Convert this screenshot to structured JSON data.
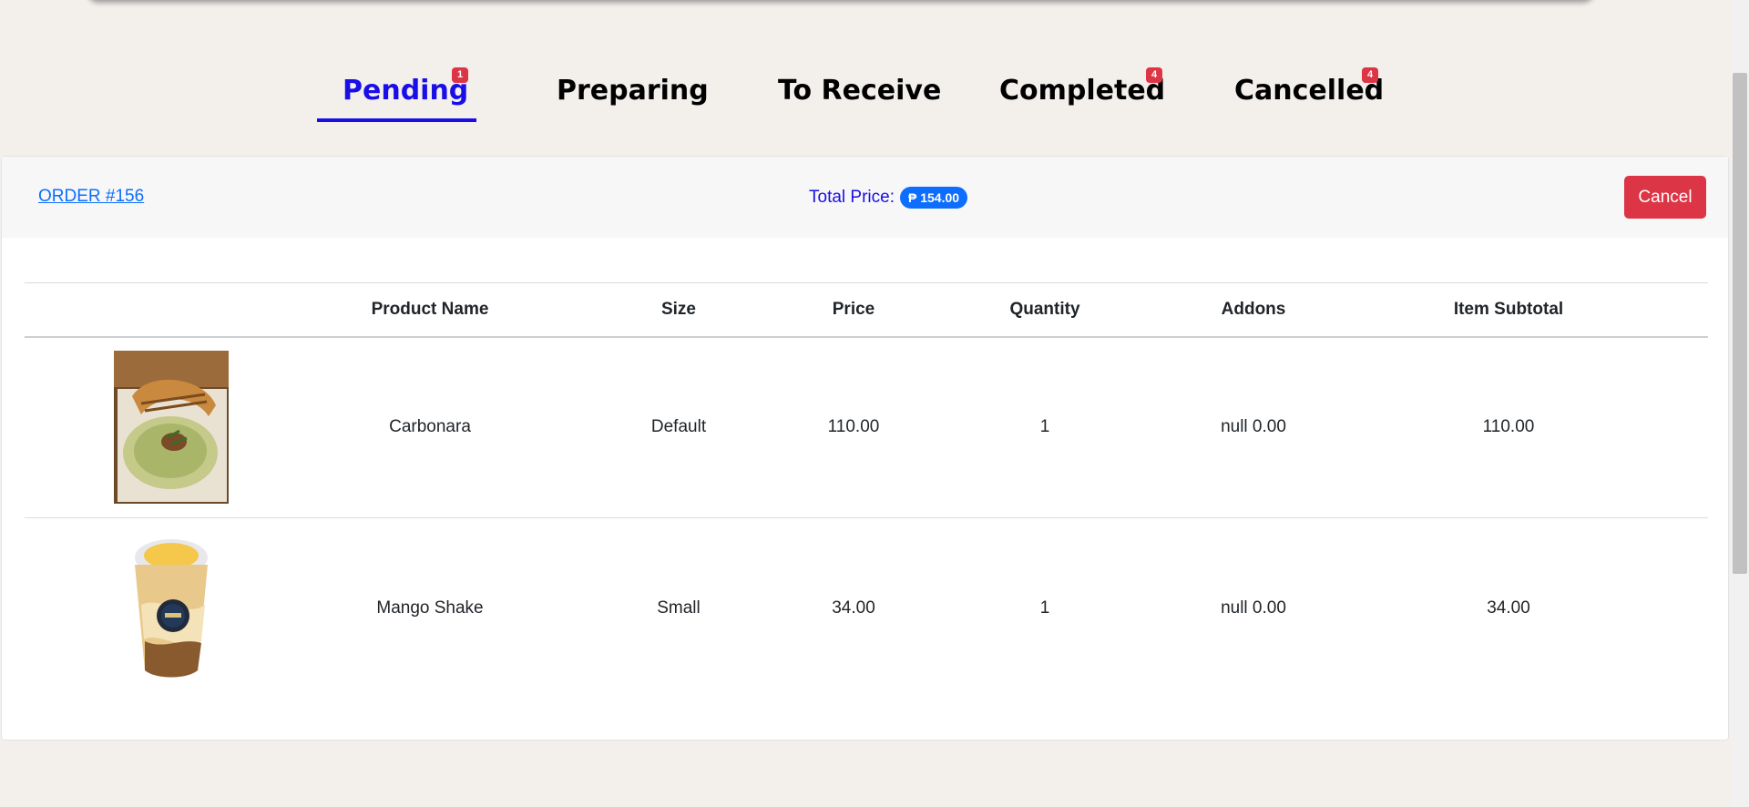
{
  "tabs": [
    {
      "label": "Pending",
      "count": "1",
      "active": true
    },
    {
      "label": "Preparing",
      "count": "",
      "active": false
    },
    {
      "label": "To Receive",
      "count": "",
      "active": false
    },
    {
      "label": "Completed",
      "count": "4",
      "active": false
    },
    {
      "label": "Cancelled",
      "count": "4",
      "active": false
    }
  ],
  "order": {
    "title": "ORDER #156",
    "total_label": "Total Price:",
    "total_value": "₱ 154.00",
    "cancel_label": "Cancel"
  },
  "table": {
    "headers": [
      "",
      "Product Name",
      "Size",
      "Price",
      "Quantity",
      "Addons",
      "Item Subtotal"
    ],
    "rows": [
      {
        "image": "carbonara-photo",
        "name": "Carbonara",
        "size": "Default",
        "price": "110.00",
        "quantity": "1",
        "addons": "null 0.00",
        "subtotal": "110.00"
      },
      {
        "image": "mango-shake-photo",
        "name": "Mango Shake",
        "size": "Small",
        "price": "34.00",
        "quantity": "1",
        "addons": "null 0.00",
        "subtotal": "34.00"
      }
    ]
  },
  "colors": {
    "active_tab": "#1a0ee8",
    "badge_red": "#dc3545",
    "price_badge": "#0d6efd",
    "link": "#0d6efd"
  }
}
